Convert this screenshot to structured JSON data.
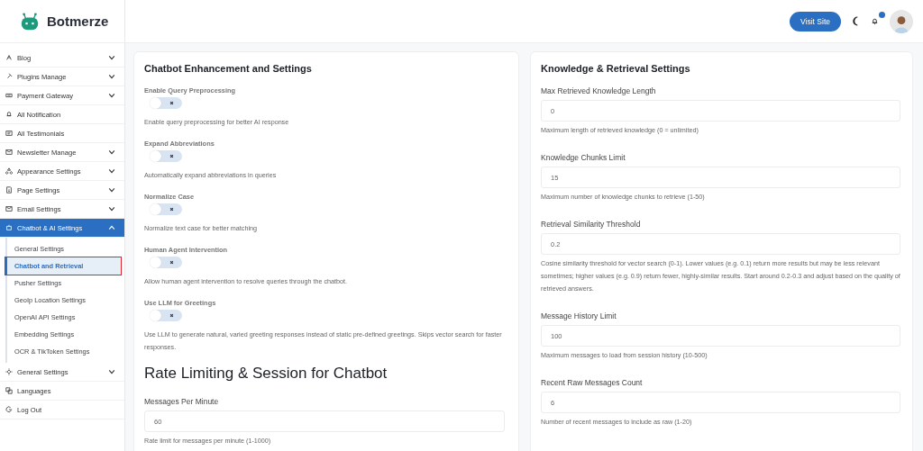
{
  "brand": {
    "name": "Botmerze"
  },
  "header": {
    "visit_button": "Visit Site",
    "notification_badge": true
  },
  "sidebar": {
    "items": [
      {
        "label": "Blog",
        "has_submenu": true,
        "expanded": false,
        "selected": false
      },
      {
        "label": "Plugins Manage",
        "has_submenu": true,
        "expanded": false,
        "selected": false
      },
      {
        "label": "Payment Gateway",
        "has_submenu": true,
        "expanded": false,
        "selected": false
      },
      {
        "label": "All Notification",
        "has_submenu": false,
        "selected": false
      },
      {
        "label": "All Testimonials",
        "has_submenu": false,
        "selected": false
      },
      {
        "label": "Newsletter Manage",
        "has_submenu": true,
        "expanded": false,
        "selected": false
      },
      {
        "label": "Appearance Settings",
        "has_submenu": true,
        "expanded": false,
        "selected": false
      },
      {
        "label": "Page Settings",
        "has_submenu": true,
        "expanded": false,
        "selected": false
      },
      {
        "label": "Email Settings",
        "has_submenu": true,
        "expanded": false,
        "selected": false
      },
      {
        "label": "Chatbot & AI Settings",
        "has_submenu": true,
        "expanded": true,
        "selected": true,
        "children": [
          {
            "label": "General Settings",
            "selected": false,
            "highlighted": false
          },
          {
            "label": "Chatbot and Retrieval",
            "selected": true,
            "highlighted": true
          },
          {
            "label": "Pusher Settings",
            "selected": false,
            "highlighted": false
          },
          {
            "label": "GeoIp Location Settings",
            "selected": false,
            "highlighted": false
          },
          {
            "label": "OpenAI API Settings",
            "selected": false,
            "highlighted": false
          },
          {
            "label": "Embedding Settings",
            "selected": false,
            "highlighted": false
          },
          {
            "label": "OCR & TikToken Settings",
            "selected": false,
            "highlighted": false
          }
        ]
      },
      {
        "label": "General Settings",
        "has_submenu": true,
        "expanded": false,
        "selected": false
      },
      {
        "label": "Languages",
        "has_submenu": false,
        "selected": false
      },
      {
        "label": "Log Out",
        "has_submenu": false,
        "selected": false
      }
    ]
  },
  "enhancement_card": {
    "title": "Chatbot Enhancement and Settings",
    "toggles": [
      {
        "label": "Enable Query Preprocessing",
        "on": false,
        "help": "Enable query preprocessing for better AI response"
      },
      {
        "label": "Expand Abbreviations",
        "on": false,
        "help": "Automatically expand abbreviations in queries"
      },
      {
        "label": "Normalize Case",
        "on": false,
        "help": "Normalize text case for better matching"
      },
      {
        "label": "Human Agent Intervention",
        "on": false,
        "help": "Allow human agent intervention to resolve queries through the chatbot."
      },
      {
        "label": "Use LLM for Greetings",
        "on": false,
        "help": "Use LLM to generate natural, varied greeting responses instead of static pre-defined greetings. Skips vector search for faster responses."
      }
    ],
    "section_heading": "Rate Limiting & Session for Chatbot",
    "fields": [
      {
        "label": "Messages Per Minute",
        "value": "60",
        "help": "Rate limit for messages per minute (1-1000)"
      }
    ]
  },
  "knowledge_card": {
    "title": "Knowledge & Retrieval Settings",
    "fields": [
      {
        "label": "Max Retrieved Knowledge Length",
        "value": "0",
        "help": "Maximum length of retrieved knowledge (0 = unlimited)"
      },
      {
        "label": "Knowledge Chunks Limit",
        "value": "15",
        "help": "Maximum number of knowledge chunks to retrieve (1-50)"
      },
      {
        "label": "Retrieval Similarity Threshold",
        "value": "0.2",
        "help": "Cosine similarity threshold for vector search (0-1). Lower values (e.g. 0.1) return more results but may be less relevant sometimes; higher values (e.g. 0.9) return fewer, highly-similar results. Start around 0.2-0.3 and adjust based on the quality of retrieved answers."
      },
      {
        "label": "Message History Limit",
        "value": "100",
        "help": "Maximum messages to load from session history (10-500)"
      },
      {
        "label": "Recent Raw Messages Count",
        "value": "6",
        "help": "Number of recent messages to include as raw (1-20)"
      }
    ]
  }
}
